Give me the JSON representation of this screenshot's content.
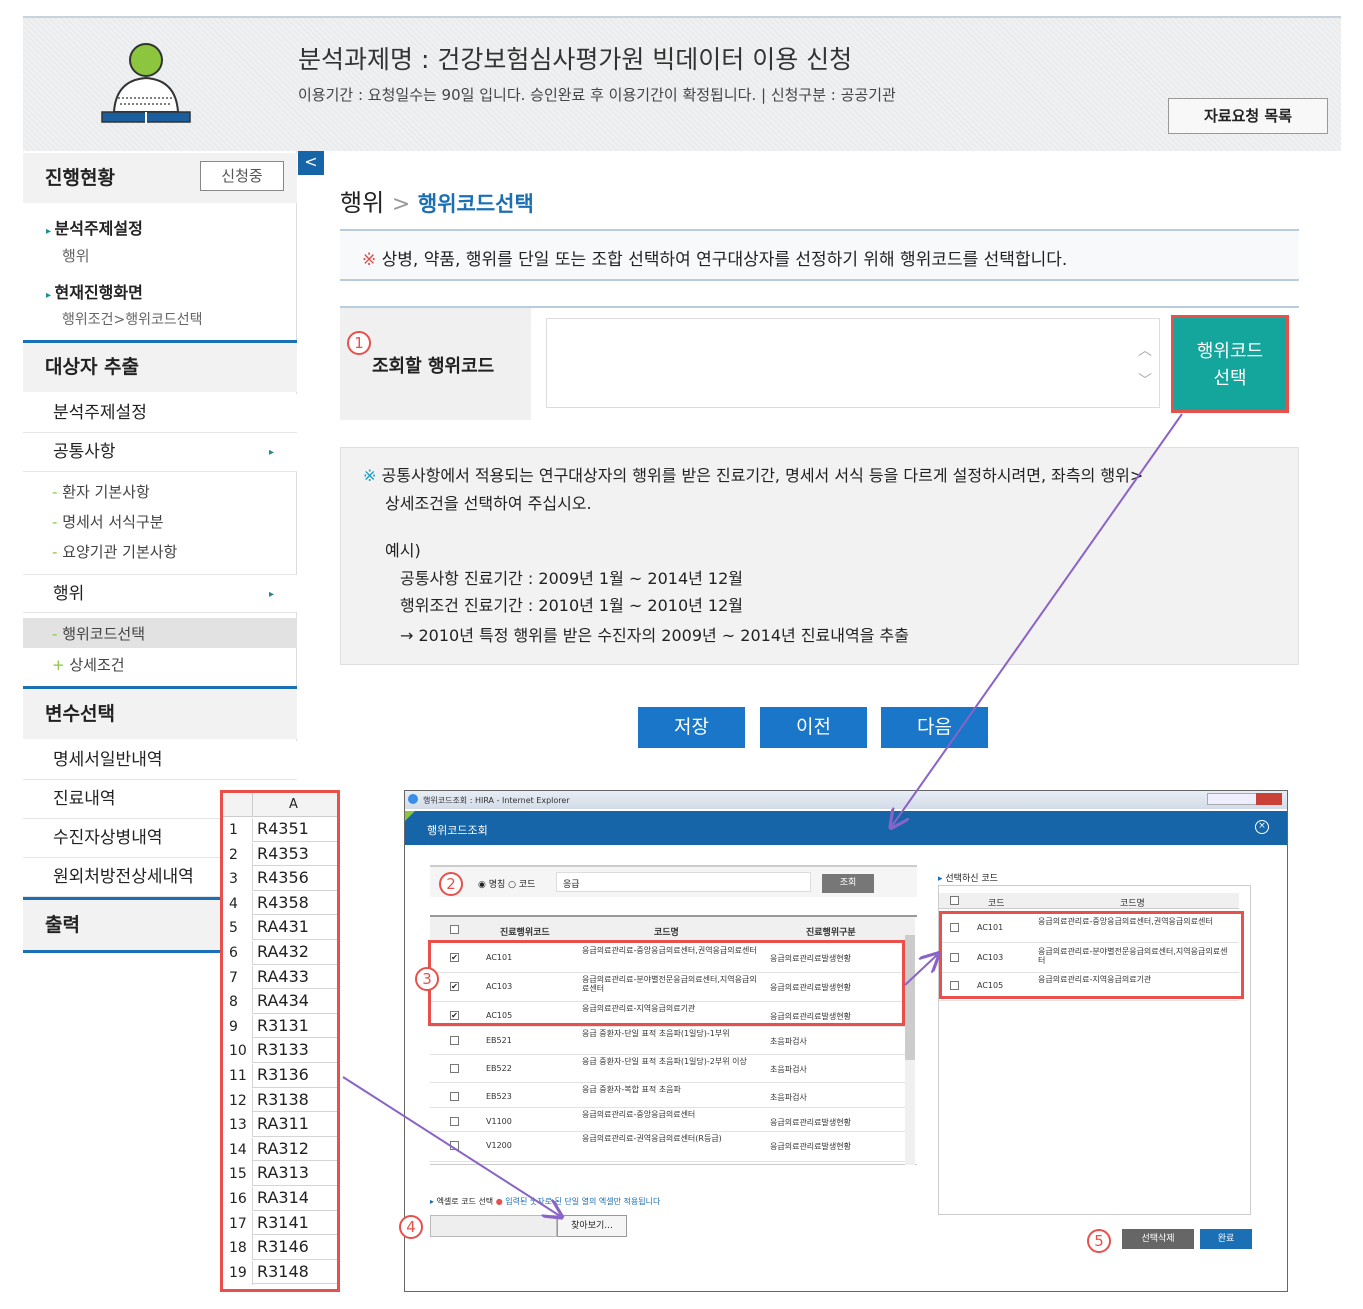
{
  "header": {
    "title": "분석과제명 : 건강보험심사평가원 빅데이터 이용 신청",
    "subtitle": "이용기간 : 요청일수는 90일 입니다. 승인완료 후 이용기간이 확정됩니다.  |  신청구분 : 공공기관",
    "data_list_button": "자료요청 목록"
  },
  "sidebar": {
    "progress_title": "진행현황",
    "progress_badge": "신청중",
    "topic_label": "분석주제설정",
    "topic_value": "행위",
    "current_label": "현재진행화면",
    "current_value": "행위조건>행위코드선택",
    "extract_title": "대상자 추출",
    "extract_items": [
      "분석주제설정",
      "공통사항"
    ],
    "common_subs": [
      "환자 기본사항",
      "명세서 서식구분",
      "요양기관 기본사항"
    ],
    "behavior_label": "행위",
    "behavior_subs": [
      "행위코드선택",
      "상세조건"
    ],
    "vars_title": "변수선택",
    "vars_items": [
      "명세서일반내역",
      "진료내역",
      "수진자상병내역",
      "원외처방전상세내역"
    ],
    "output_title": "출력",
    "collapse": "<"
  },
  "main": {
    "crumb_parent": "행위",
    "crumb_sep": ">",
    "crumb_current": "행위코드선택",
    "notice1": "상병, 약품, 행위를 단일 또는 조합 선택하여 연구대상자를 선정하기 위해 행위코드를 선택합니다.",
    "asterisk": "※",
    "query_label": "조회할 행위코드",
    "select_button": "행위코드\n선택",
    "notice2_line1": "공통사항에서 적용되는 연구대상자의 행위를 받은 진료기간, 명세서 서식 등을 다르게 설정하시려면, 좌측의 행위>",
    "notice2_line2": "상세조건을 선택하여 주십시오.",
    "example_title": "예시)",
    "example_lines": [
      "공통사항 진료기간 : 2009년 1월 ~ 2014년 12월",
      "행위조건 진료기간 : 2010년 1월 ~ 2010년 12월",
      "→ 2010년 특정 행위를 받은 수진자의 2009년 ~ 2014년 진료내역을 추출"
    ],
    "buttons": [
      "저장",
      "이전",
      "다음"
    ]
  },
  "markers": [
    "1",
    "2",
    "3",
    "4",
    "5"
  ],
  "popup": {
    "window_title": "행위코드조회 : HIRA - Internet Explorer",
    "title": "행위코드조회",
    "radio_name": "명칭",
    "radio_code": "코드",
    "search_value": "응급",
    "search_button": "조회",
    "columns": [
      "진료행위코드",
      "코드명",
      "진료행위구분"
    ],
    "rows": [
      {
        "code": "AC101",
        "name": "응급의료관리료-중앙응급의료센터,권역응급의료센터",
        "type": "응급의료관리료발생현황",
        "checked": true
      },
      {
        "code": "AC103",
        "name": "응급의료관리료-분야별전문응급의료센터,지역응급의료센터",
        "type": "응급의료관리료발생현황",
        "checked": true
      },
      {
        "code": "AC105",
        "name": "응급의료관리료-지역응급의료기관",
        "type": "응급의료관리료발생현황",
        "checked": true
      },
      {
        "code": "EB521",
        "name": "응급 중환자-단일 표적 초음파(1일당)-1부위",
        "type": "초음파검사",
        "checked": false
      },
      {
        "code": "EB522",
        "name": "응급 중환자-단일 표적 초음파(1일당)-2부위 이상",
        "type": "초음파검사",
        "checked": false
      },
      {
        "code": "EB523",
        "name": "응급 중환자-복합 표적 초음파",
        "type": "초음파검사",
        "checked": false
      },
      {
        "code": "V1100",
        "name": "응급의료관리료-중앙응급의료센터",
        "type": "응급의료관리료발생현황",
        "checked": false
      },
      {
        "code": "V1200",
        "name": "응급의료관리료-권역응급의료센터(R등급)",
        "type": "응급의료관리료발생현황",
        "checked": false
      }
    ],
    "selected_title": "선택하신 코드",
    "selected_columns": [
      "코드",
      "코드명"
    ],
    "selected_rows": [
      {
        "code": "AC101",
        "name": "응급의료관리료-중앙응급의료센터,권역응급의료센터"
      },
      {
        "code": "AC103",
        "name": "응급의료관리료-분야별전문응급의료센터,지역응급의료센터"
      },
      {
        "code": "AC105",
        "name": "응급의료관리료-지역응급의료기관"
      }
    ],
    "excel_label": "엑셀로 코드 선택",
    "excel_note": "입력된 숫자로 된 단일 열의 엑셀만 적용됩니다",
    "browse_button": "찾아보기...",
    "delete_button": "선택삭제",
    "done_button": "완료"
  },
  "excel": {
    "column": "A",
    "rows": [
      "R4351",
      "R4353",
      "R4356",
      "R4358",
      "RA431",
      "RA432",
      "RA433",
      "RA434",
      "R3131",
      "R3133",
      "R3136",
      "R3138",
      "RA311",
      "RA312",
      "RA313",
      "RA314",
      "R3141",
      "R3146",
      "R3148"
    ]
  },
  "colors": {
    "accent": "#1976c8",
    "teal": "#14a69c",
    "highlight": "#e8504c",
    "arrow": "#8a63c7"
  }
}
